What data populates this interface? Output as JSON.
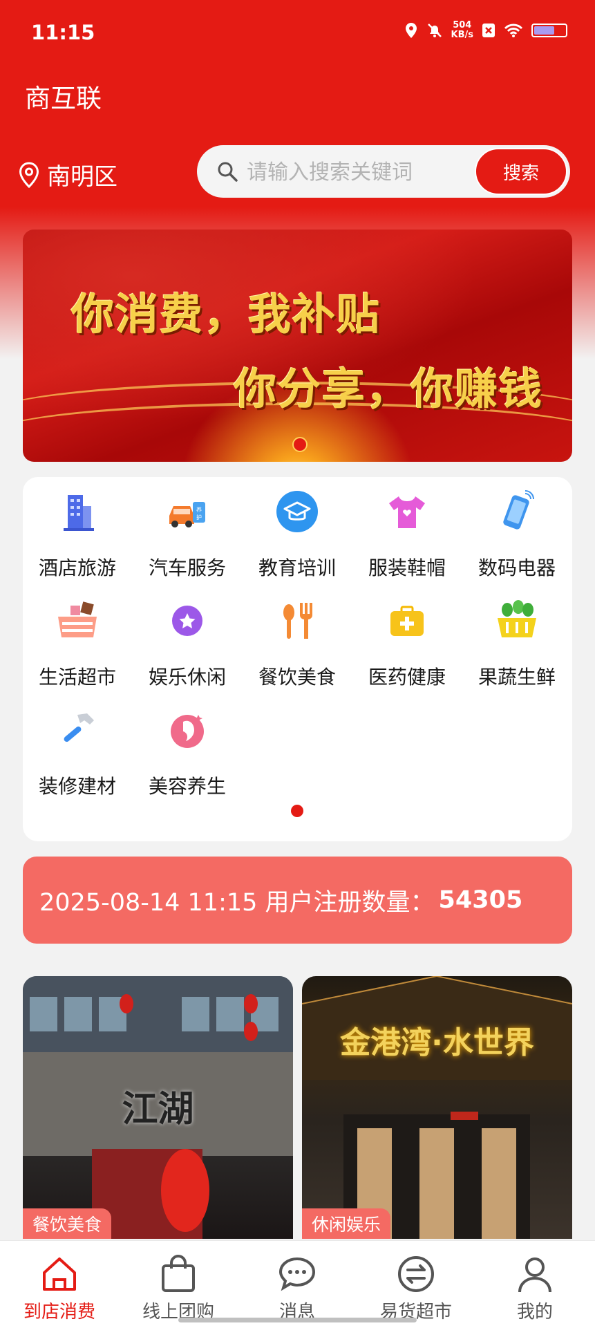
{
  "status_bar": {
    "time": "11:15",
    "net_speed_value": "504",
    "net_speed_unit": "KB/s"
  },
  "header": {
    "app_title": "商互联",
    "location": "南明区",
    "search": {
      "placeholder": "请输入搜索关键词",
      "value": "",
      "button_label": "搜索"
    }
  },
  "banner": {
    "line1": "你消费，我补贴",
    "line2": "你分享，你赚钱"
  },
  "categories": [
    {
      "label": "酒店旅游",
      "icon": "hotel-building-icon"
    },
    {
      "label": "汽车服务",
      "icon": "car-service-icon"
    },
    {
      "label": "教育培训",
      "icon": "graduation-cap-icon"
    },
    {
      "label": "服装鞋帽",
      "icon": "tshirt-icon"
    },
    {
      "label": "数码电器",
      "icon": "phone-icon"
    },
    {
      "label": "生活超市",
      "icon": "basket-icon"
    },
    {
      "label": "娱乐休闲",
      "icon": "star-badge-icon"
    },
    {
      "label": "餐饮美食",
      "icon": "utensils-icon"
    },
    {
      "label": "医药健康",
      "icon": "medical-kit-icon"
    },
    {
      "label": "果蔬生鲜",
      "icon": "vegetable-basket-icon"
    },
    {
      "label": "装修建材",
      "icon": "hammer-icon"
    },
    {
      "label": "美容养生",
      "icon": "beauty-face-icon"
    }
  ],
  "stats": {
    "text": "2025-08-14 11:15 用户注册数量：",
    "count": "54305"
  },
  "stores": [
    {
      "tag": "餐饮美食",
      "sign": "江湖"
    },
    {
      "tag": "休闲娱乐",
      "sign": "金港湾·水世界"
    }
  ],
  "tabs": [
    {
      "label": "到店消费",
      "icon": "storefront-icon",
      "active": true
    },
    {
      "label": "线上团购",
      "icon": "shopping-bag-icon",
      "active": false
    },
    {
      "label": "消息",
      "icon": "chat-bubble-icon",
      "active": false
    },
    {
      "label": "易货超市",
      "icon": "exchange-icon",
      "active": false
    },
    {
      "label": "我的",
      "icon": "user-icon",
      "active": false
    }
  ],
  "colors": {
    "primary": "#e41b14",
    "stats_bg": "#f46a63",
    "page_bg": "#f2f2f2"
  }
}
